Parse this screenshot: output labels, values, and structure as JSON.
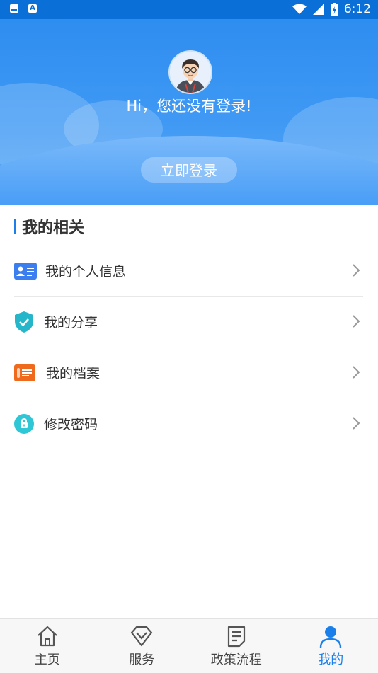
{
  "status_bar": {
    "time": "6:12"
  },
  "header": {
    "greeting": "Hi，您还没有登录!",
    "login_button": "立即登录"
  },
  "section": {
    "title": "我的相关",
    "items": [
      {
        "label": "我的个人信息",
        "icon": "id-card-icon",
        "color": "#3b7ef0"
      },
      {
        "label": "我的分享",
        "icon": "shield-check-icon",
        "color": "#26b6c9"
      },
      {
        "label": "我的档案",
        "icon": "file-archive-icon",
        "color": "#f06a1e"
      },
      {
        "label": "修改密码",
        "icon": "lock-icon",
        "color": "#2fc6d6"
      }
    ]
  },
  "tabbar": {
    "tabs": [
      {
        "label": "主页",
        "icon": "home-icon"
      },
      {
        "label": "服务",
        "icon": "diamond-icon"
      },
      {
        "label": "政策流程",
        "icon": "document-icon"
      },
      {
        "label": "我的",
        "icon": "user-icon",
        "active": true
      }
    ]
  },
  "colors": {
    "accent": "#1a7fe8",
    "header": "#2e8df0"
  }
}
